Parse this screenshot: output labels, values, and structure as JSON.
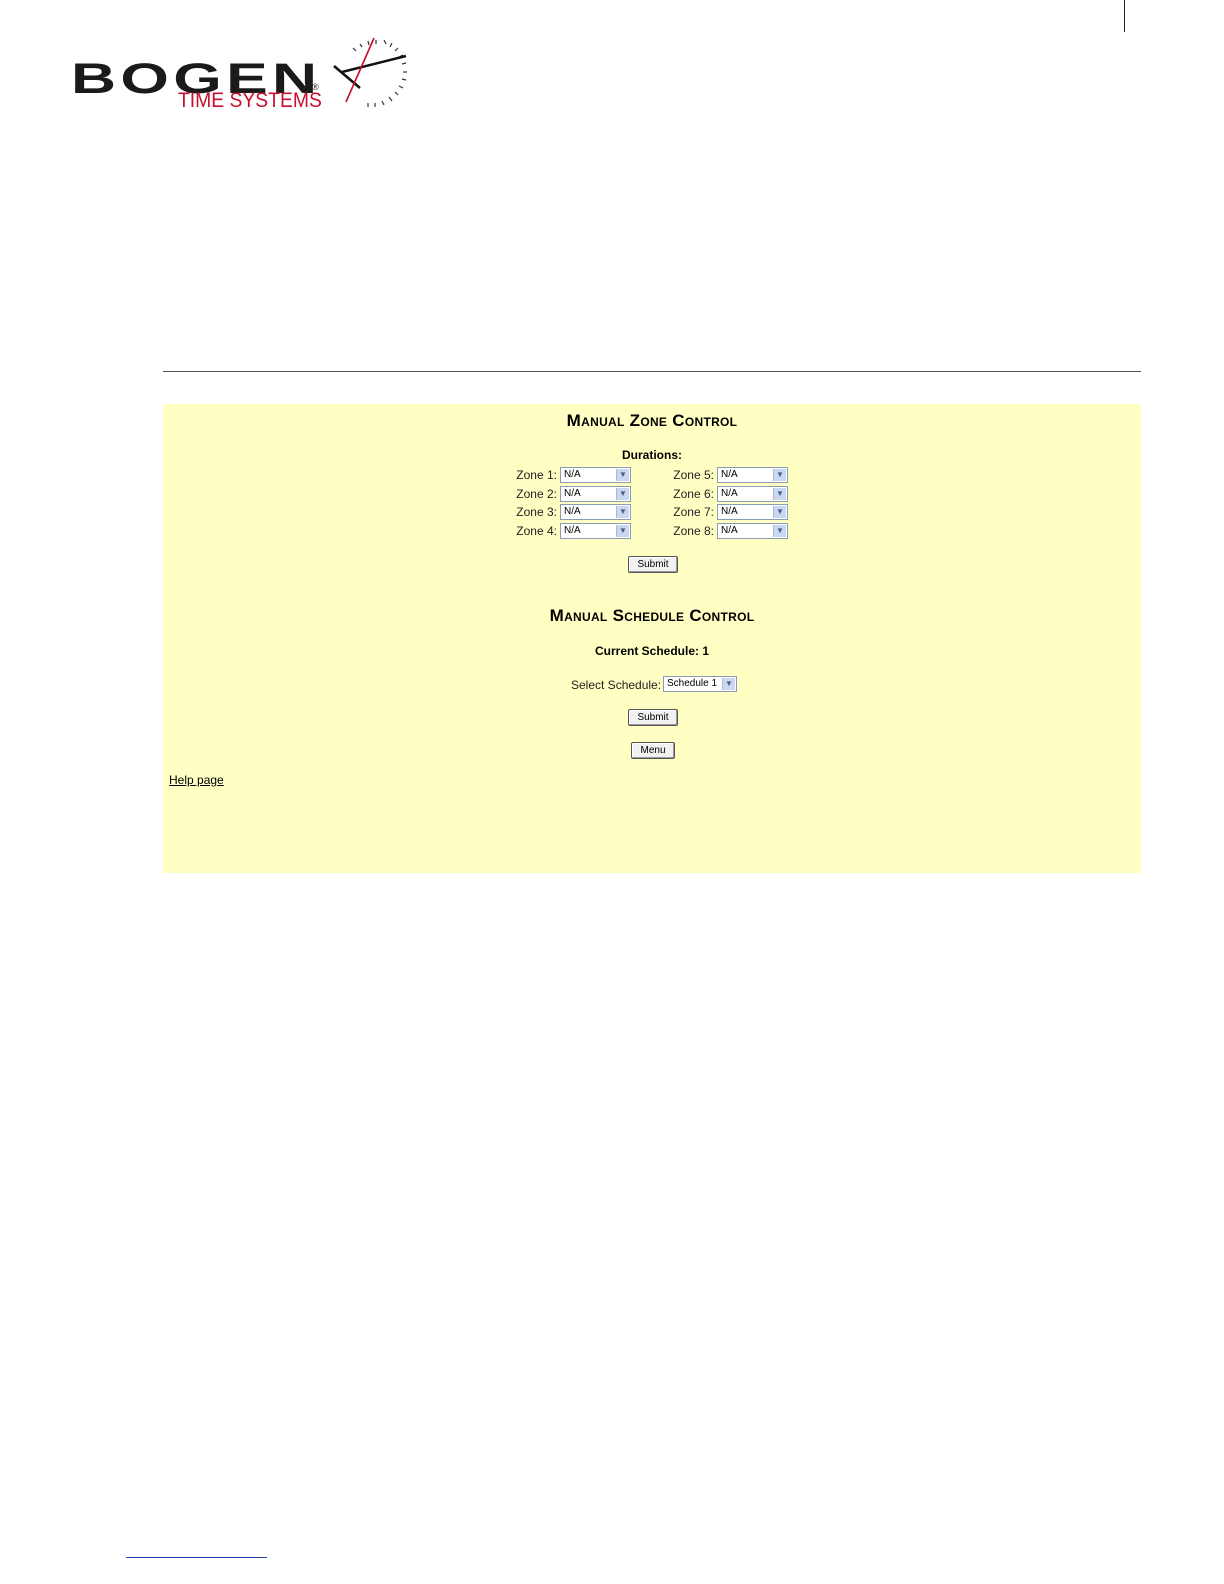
{
  "logo": {
    "word": "BOGEN",
    "registered": "®",
    "subtitle": "TIME SYSTEMS"
  },
  "manual_zone_control": {
    "title": "Manual Zone Control",
    "durations_label": "Durations:",
    "zones": [
      {
        "label": "Zone 1:",
        "value": "N/A"
      },
      {
        "label": "Zone 2:",
        "value": "N/A"
      },
      {
        "label": "Zone 3:",
        "value": "N/A"
      },
      {
        "label": "Zone 4:",
        "value": "N/A"
      },
      {
        "label": "Zone 5:",
        "value": "N/A"
      },
      {
        "label": "Zone 6:",
        "value": "N/A"
      },
      {
        "label": "Zone 7:",
        "value": "N/A"
      },
      {
        "label": "Zone 8:",
        "value": "N/A"
      }
    ],
    "submit_label": "Submit"
  },
  "manual_schedule_control": {
    "title": "Manual Schedule Control",
    "current_schedule": "Current Schedule: 1",
    "select_label": "Select Schedule:",
    "select_value": "Schedule 1",
    "submit_label": "Submit"
  },
  "menu_label": "Menu",
  "help_link": "Help page",
  "colors": {
    "panel_background": "#ffffc4",
    "logo_red": "#c8102e"
  }
}
